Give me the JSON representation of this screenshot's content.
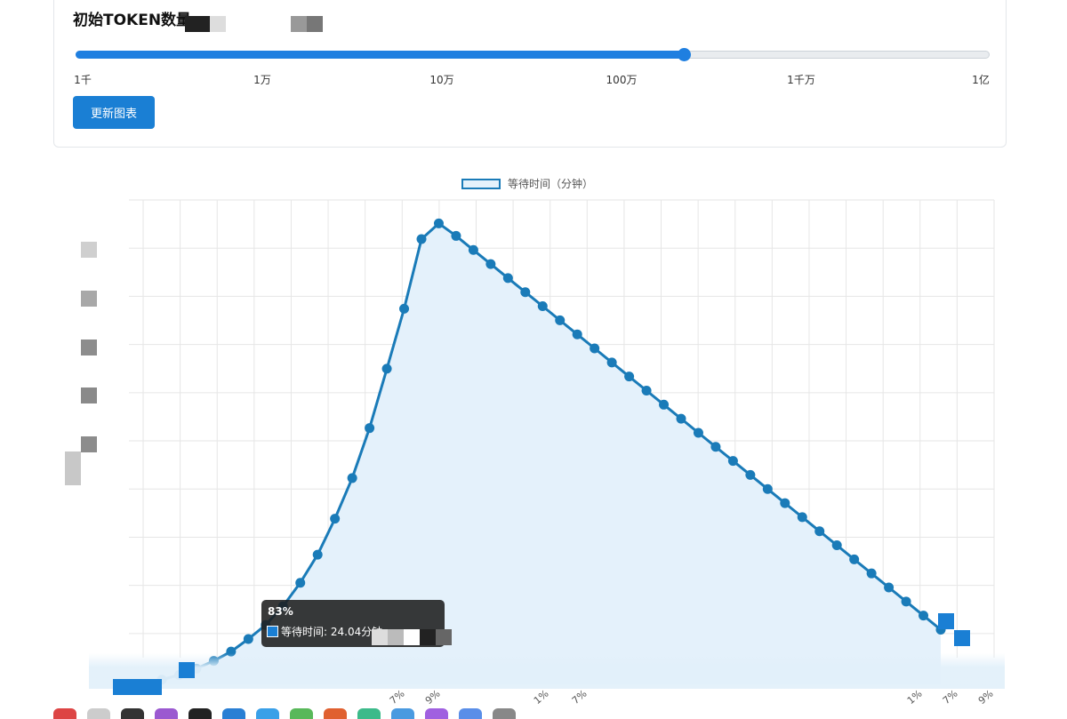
{
  "panel": {
    "title": "初始TOKEN数量"
  },
  "slider": {
    "value_label": "100万",
    "value_position_fraction": 0.665,
    "ticks": [
      "1千",
      "1万",
      "10万",
      "100万",
      "1千万",
      "1亿"
    ]
  },
  "update_button": {
    "label": "更新图表"
  },
  "legend": {
    "label": "等待时间（分钟）"
  },
  "tooltip": {
    "title": "83%",
    "label": "等待时间: 24.04分钟"
  },
  "x_axis_labels_visible": [
    "7%",
    "9%",
    "1%",
    "7%",
    "1%",
    "7%",
    "9%"
  ],
  "colors": {
    "accent": "#1f7fe0",
    "line": "#1a7bb8",
    "area": "#e4f1fb",
    "grid": "#e6e6e6",
    "tooltip_bg": "#1e1e1e"
  },
  "chart_data": {
    "type": "line",
    "series": [
      {
        "name": "等待时间（分钟）",
        "values": [
          0.3,
          0.6,
          1.0,
          1.5,
          2.1,
          2.9,
          3.8,
          5.0,
          6.5,
          8.3,
          10.6,
          13.2,
          16.4,
          20.2,
          24.04,
          28.5,
          29.5,
          28.7,
          27.8,
          26.9,
          26.0,
          25.1,
          24.2,
          23.3,
          22.4,
          21.5,
          20.6,
          19.7,
          18.8,
          17.9,
          17.0,
          16.1,
          15.2,
          14.3,
          13.4,
          12.5,
          11.6,
          10.7,
          9.8,
          8.9,
          8.0,
          7.1,
          6.2,
          5.3,
          4.4,
          3.5
        ],
        "filled": true
      }
    ],
    "grid": true,
    "legend": "top-center"
  }
}
